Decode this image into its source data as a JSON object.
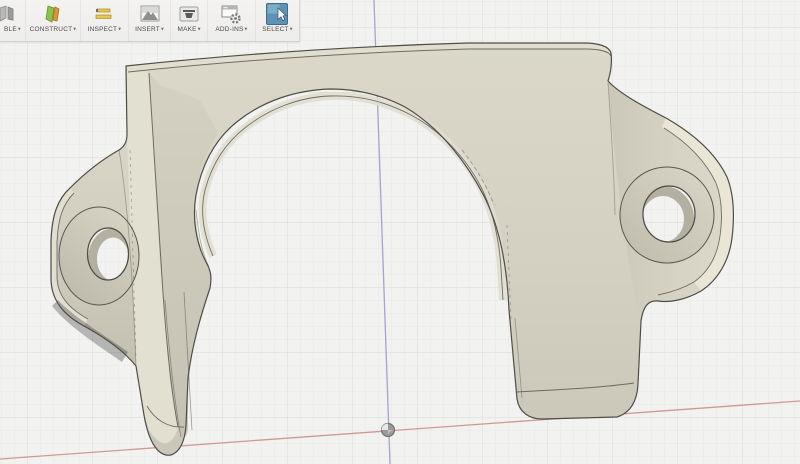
{
  "app": {
    "name": "Fusion 360 modeling viewport"
  },
  "toolbar": {
    "caret": "▾",
    "items": [
      {
        "id": "assemble",
        "label": "BLE"
      },
      {
        "id": "construct",
        "label": "CONSTRUCT"
      },
      {
        "id": "inspect",
        "label": "INSPECT"
      },
      {
        "id": "insert",
        "label": "INSERT"
      },
      {
        "id": "make",
        "label": "MAKE"
      },
      {
        "id": "addins",
        "label": "ADD-INS"
      },
      {
        "id": "select",
        "label": "SELECT",
        "active": true
      }
    ]
  },
  "viewport": {
    "content": "beige U-shaped clamp bracket with two mounting ear holes, shown in perspective over ground grid",
    "origin_marker": "sphere dot at world origin"
  },
  "colors": {
    "canvas_bg": "#f2f2f0",
    "grid_minor": "#e8e8e6",
    "grid_major": "#dbdbd9",
    "axis_x": "#cf8e8e",
    "axis_z": "#9797c8",
    "model_face": "#d5d2c4",
    "model_side_light": "#e9e6d6",
    "model_edge": "#53514a",
    "select_active_blue": "#5f92b4",
    "toolbar_bg": "#f2f1ef"
  }
}
